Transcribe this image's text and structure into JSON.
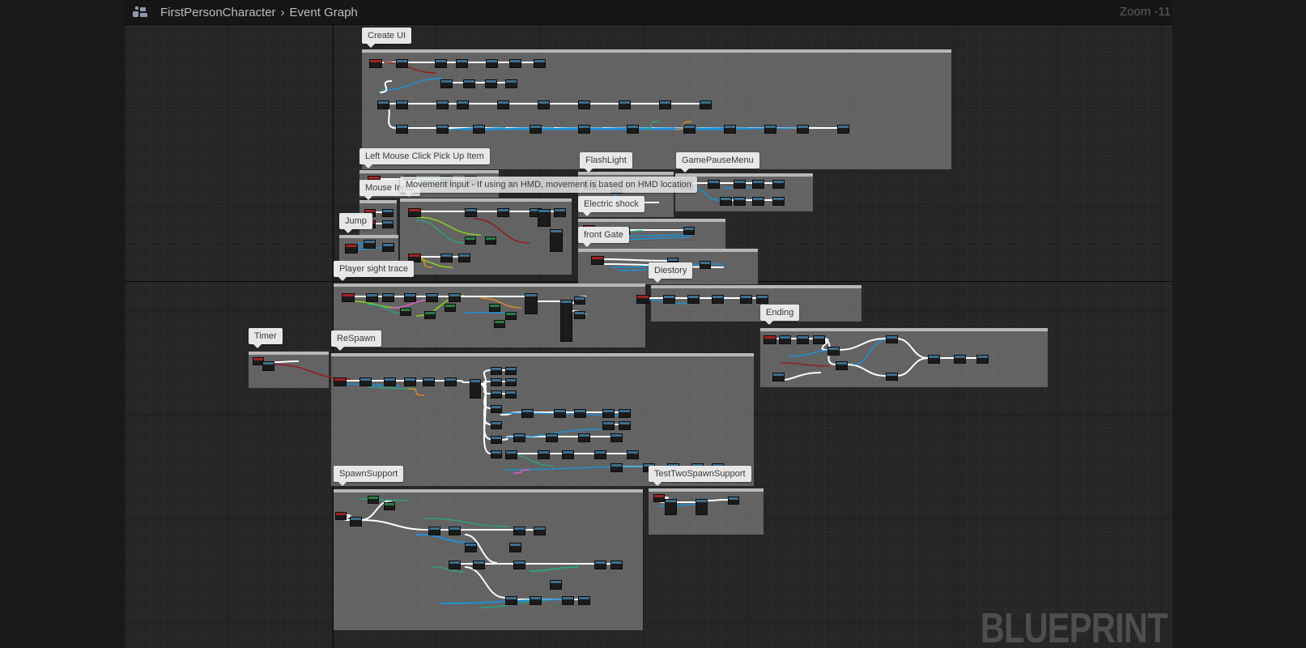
{
  "header": {
    "breadcrumb_root": "FirstPersonCharacter",
    "breadcrumb_separator": "›",
    "breadcrumb_current": "Event Graph",
    "zoom_label": "Zoom -11",
    "icon": "blueprint-graph-icon"
  },
  "watermark": "BLUEPRINT",
  "comments": [
    {
      "id": "create-ui",
      "label": "Create UI"
    },
    {
      "id": "left-mouse",
      "label": "Left Mouse Click Pick Up Item"
    },
    {
      "id": "flashlight",
      "label": "FlashLight"
    },
    {
      "id": "gamepause",
      "label": "GamePauseMenu"
    },
    {
      "id": "mouse-input",
      "label": "Mouse Input"
    },
    {
      "id": "movement",
      "label": "Movement input - If using an HMD, movement is based on HMD location"
    },
    {
      "id": "electric",
      "label": "Electric shock"
    },
    {
      "id": "jump",
      "label": "Jump"
    },
    {
      "id": "frontgate",
      "label": "front Gate"
    },
    {
      "id": "sight",
      "label": "Player sight trace"
    },
    {
      "id": "diestory",
      "label": "Diestory"
    },
    {
      "id": "ending",
      "label": "Ending"
    },
    {
      "id": "timer",
      "label": "Timer"
    },
    {
      "id": "respawn",
      "label": "ReSpawn"
    },
    {
      "id": "spawnsupport",
      "label": "SpawnSupport"
    },
    {
      "id": "testtwo",
      "label": "TestTwoSpawnSupport"
    }
  ],
  "colors": {
    "exec_wire": "#ffffff",
    "object_wire": "#1e90d8",
    "bool_wire": "#8f1f1f",
    "struct_wire": "#2f9f7f",
    "float_wire": "#8ad21e",
    "string_wire": "#e05fd5",
    "int_wire": "#e08a2e",
    "event_header": "#a32222",
    "function_header": "#3d6f8f",
    "comment_fill": "#7b7b7b"
  }
}
